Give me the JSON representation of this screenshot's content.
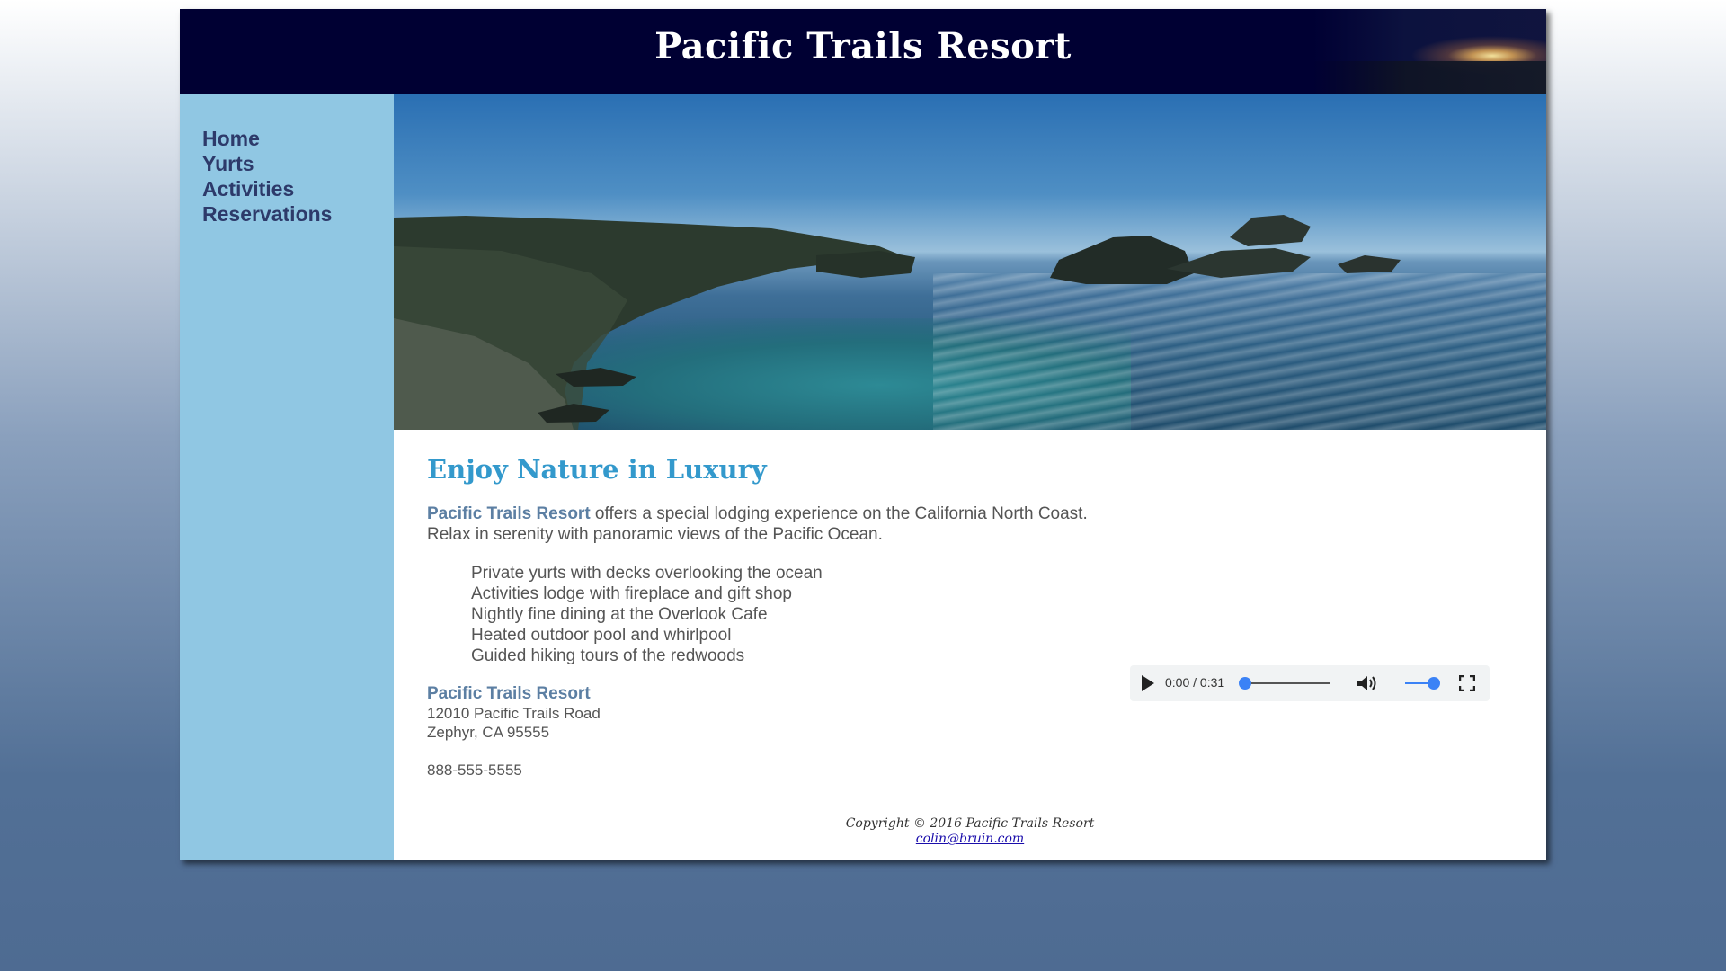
{
  "header": {
    "title": "Pacific Trails Resort"
  },
  "nav": {
    "items": [
      {
        "label": "Home"
      },
      {
        "label": "Yurts"
      },
      {
        "label": "Activities"
      },
      {
        "label": "Reservations"
      }
    ]
  },
  "main": {
    "heading": "Enjoy Nature in Luxury",
    "intro_brand": "Pacific Trails Resort",
    "intro_line1_rest": " offers a special lodging experience on the California North Coast.",
    "intro_line2": "Relax in serenity with panoramic views of the Pacific Ocean.",
    "features": [
      "Private yurts with decks overlooking the ocean",
      "Activities lodge with fireplace and gift shop",
      "Nightly fine dining at the Overlook Cafe",
      "Heated outdoor pool and whirlpool",
      "Guided hiking tours of the redwoods"
    ],
    "contact": {
      "name": "Pacific Trails Resort",
      "street": "12010 Pacific Trails Road",
      "city": "Zephyr, CA 95555",
      "phone": "888-555-5555"
    }
  },
  "media_player": {
    "time": "0:00 / 0:31",
    "progress_fraction": 0.0,
    "volume_fraction": 1.0,
    "icons": [
      "play-icon",
      "volume-icon",
      "fullscreen-icon"
    ]
  },
  "footer": {
    "copyright": "Copyright © 2016 Pacific Trails Resort",
    "email": "colin@bruin.com"
  },
  "colors": {
    "header_bg": "#000033",
    "sidebar_bg": "#90c7e3",
    "heading": "#3399cc",
    "brand_text": "#5c7fa3",
    "nav_text": "#2d3a6a",
    "body_text": "#555555"
  }
}
